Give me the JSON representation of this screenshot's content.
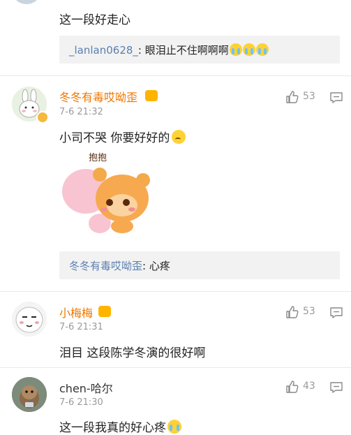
{
  "top_comment": {
    "text": "这一段好走心"
  },
  "top_reply": {
    "user": "_lanlan0628_",
    "sep": ": ",
    "text": "眼泪止不住啊啊啊"
  },
  "comments": [
    {
      "user": "冬冬有毒哎呦歪",
      "time": "7-6 21:32",
      "likes": "53",
      "text": "小司不哭  你要好好的",
      "sticker_text": "抱抱",
      "reply": {
        "user": "冬冬有毒哎呦歪",
        "sep": ": ",
        "text": "心疼"
      },
      "name_color": "#ee7700"
    },
    {
      "user": "小梅梅",
      "time": "7-6 21:31",
      "likes": "53",
      "text": "泪目 这段陈学冬演的很好啊",
      "name_color": "#ee7700"
    },
    {
      "user": "chen-哈尔",
      "time": "7-6 21:30",
      "likes": "43",
      "text": "这一段我真的好心疼",
      "name_color": "#333333"
    }
  ],
  "colors": {
    "link": "#5a7fb0",
    "meta": "#9a9a9a",
    "reply_bg": "#f2f2f2"
  }
}
